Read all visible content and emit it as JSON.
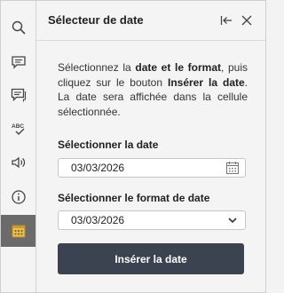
{
  "panel": {
    "title": "Sélecteur de date"
  },
  "description": {
    "p1": "Sélectionnez la ",
    "b1": "date et le format",
    "p2": ", puis cliquez sur le bouton ",
    "b2": "Insérer la date",
    "p3": ". La date sera affichée dans la cellule sélectionnée."
  },
  "date": {
    "label": "Sélectionner la date",
    "value": "03/03/2026"
  },
  "format": {
    "label": "Sélectionner le format de date",
    "value": "03/03/2026"
  },
  "insert_button": {
    "label": "Insérer la date"
  },
  "colors": {
    "button_bg": "#3c4350",
    "active_rail": "#6b6b6b"
  },
  "rail_icons": [
    "search-icon",
    "comment-icon",
    "comments-icon",
    "spellcheck-icon",
    "speaker-icon",
    "info-icon",
    "calendar-icon"
  ]
}
